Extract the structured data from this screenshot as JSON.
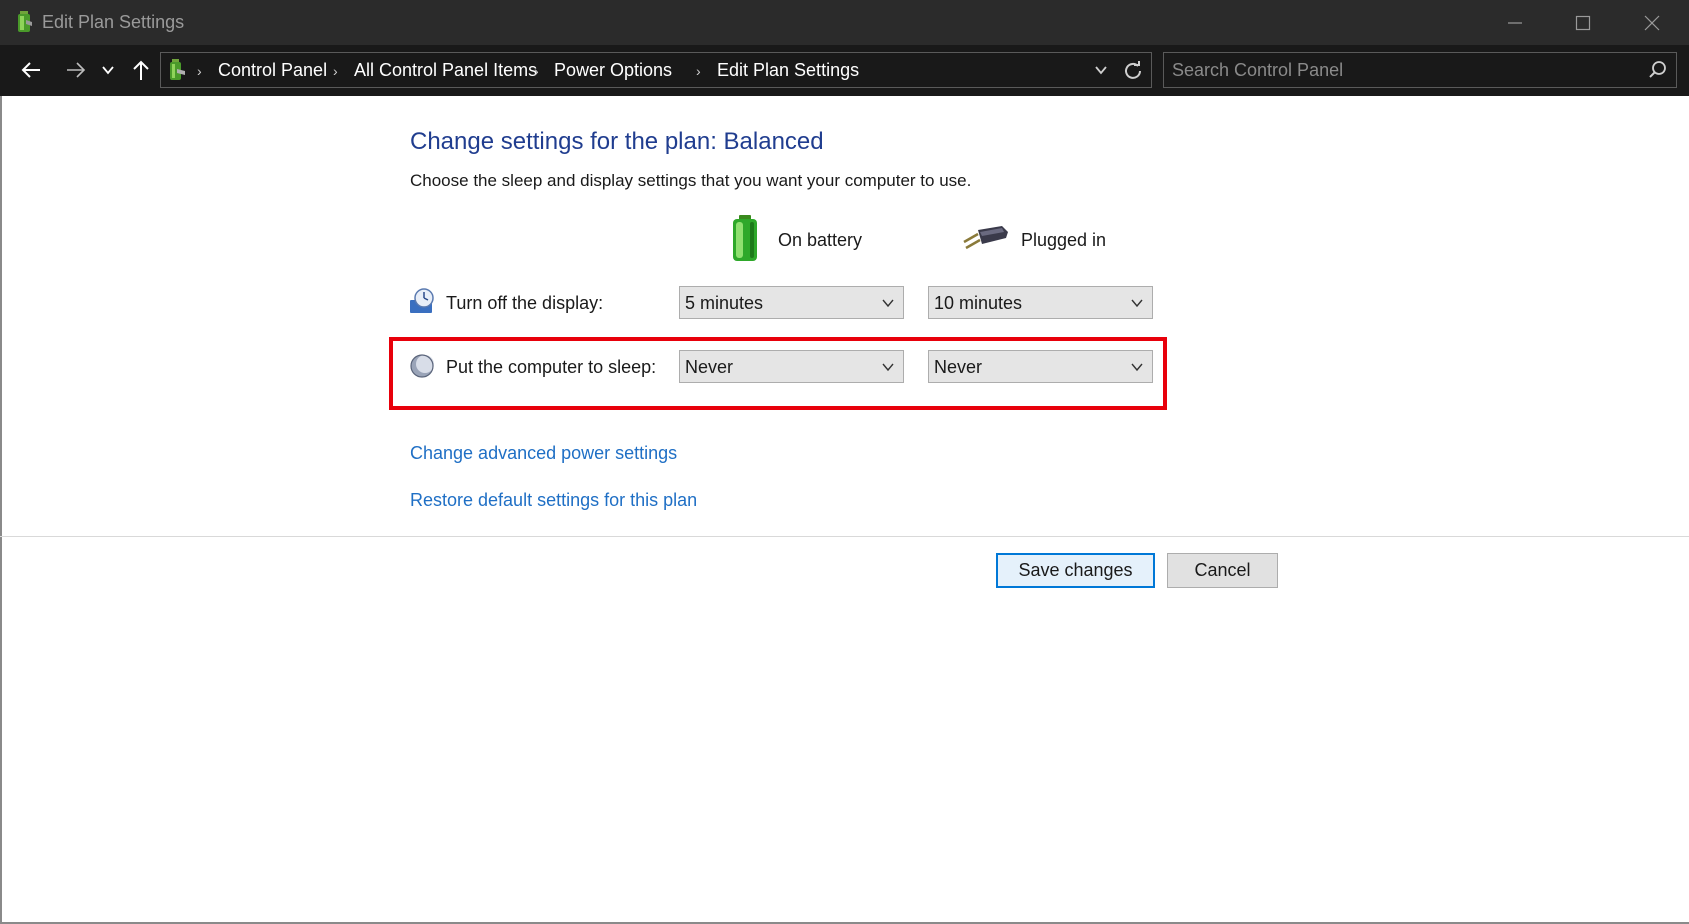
{
  "window": {
    "title": "Edit Plan Settings",
    "icon": "power-plan-battery-icon"
  },
  "address_bar": {
    "breadcrumbs": [
      "Control Panel",
      "All Control Panel Items",
      "Power Options",
      "Edit Plan Settings"
    ],
    "search_placeholder": "Search Control Panel"
  },
  "content": {
    "heading": "Change settings for the plan: Balanced",
    "description": "Choose the sleep and display settings that you want your computer to use.",
    "columns": {
      "on_battery": "On battery",
      "plugged_in": "Plugged in"
    },
    "rows": [
      {
        "label": "Turn off the display:",
        "on_battery": "5 minutes",
        "plugged_in": "10 minutes",
        "icon": "display-clock-icon"
      },
      {
        "label": "Put the computer to sleep:",
        "on_battery": "Never",
        "plugged_in": "Never",
        "icon": "sleep-moon-icon"
      }
    ],
    "links": {
      "advanced": "Change advanced power settings",
      "restore": "Restore default settings for this plan"
    }
  },
  "buttons": {
    "save": "Save changes",
    "cancel": "Cancel"
  },
  "colors": {
    "heading": "#203d8f",
    "link": "#1f6fc5",
    "highlight": "#e8000b",
    "titlebar": "#2b2b2b",
    "navbar": "#191919"
  }
}
